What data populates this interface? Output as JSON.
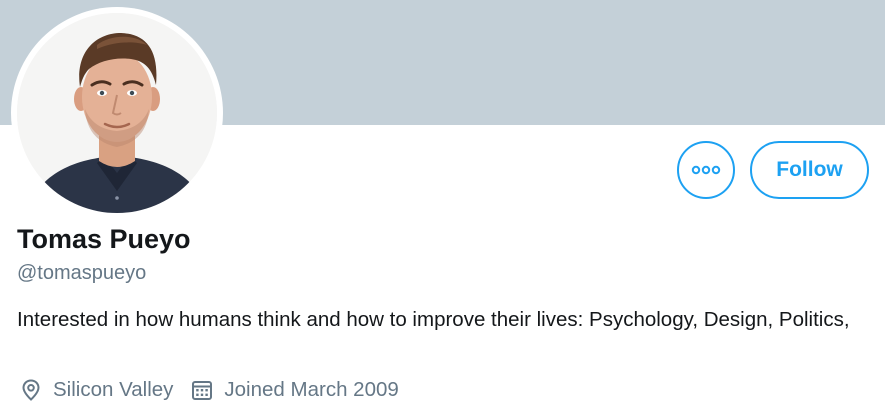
{
  "profile": {
    "display_name": "Tomas Pueyo",
    "handle": "@tomaspueyo",
    "bio": "Interested in how humans think and how to improve their lives: Psychology, Design, Politics,",
    "location": "Silicon Valley",
    "joined": "Joined March 2009"
  },
  "actions": {
    "follow_label": "Follow",
    "more_icon": "more-dots-icon"
  },
  "icons": {
    "location": "location-pin-icon",
    "calendar": "calendar-icon"
  },
  "colors": {
    "banner": "#c4d0d8",
    "accent": "#1da1f2",
    "text_primary": "#14171a",
    "text_secondary": "#657786"
  }
}
